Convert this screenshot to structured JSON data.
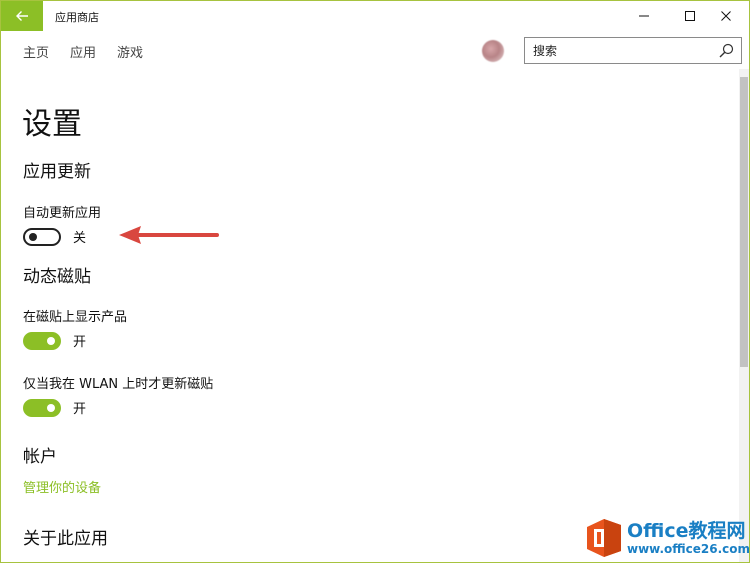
{
  "window": {
    "title": "应用商店",
    "accent_color": "#8cbf26",
    "controls": {
      "minimize_icon": "minimize-icon",
      "maximize_icon": "maximize-icon",
      "close_icon": "close-icon"
    }
  },
  "nav": {
    "items": [
      {
        "label": "主页"
      },
      {
        "label": "应用"
      },
      {
        "label": "游戏"
      }
    ]
  },
  "search": {
    "placeholder": "搜索",
    "icon": "search-icon"
  },
  "page": {
    "title": "设置"
  },
  "sections": {
    "app_updates": {
      "title": "应用更新",
      "auto_update": {
        "label": "自动更新应用",
        "state": "关",
        "on": false
      }
    },
    "live_tiles": {
      "title": "动态磁贴",
      "show_products": {
        "label": "在磁贴上显示产品",
        "state": "开",
        "on": true
      },
      "wlan_only": {
        "label": "仅当我在 WLAN 上时才更新磁贴",
        "state": "开",
        "on": true
      }
    },
    "account": {
      "title": "帐户",
      "manage_devices": "管理你的设备"
    },
    "about": {
      "title": "关于此应用"
    }
  },
  "annotation": {
    "arrow_color": "#d9473f"
  },
  "watermark": {
    "brand": "Office教程网",
    "url": "www.office26.com",
    "logo_color": "#e8541d",
    "text_color": "#1a7fc4"
  }
}
